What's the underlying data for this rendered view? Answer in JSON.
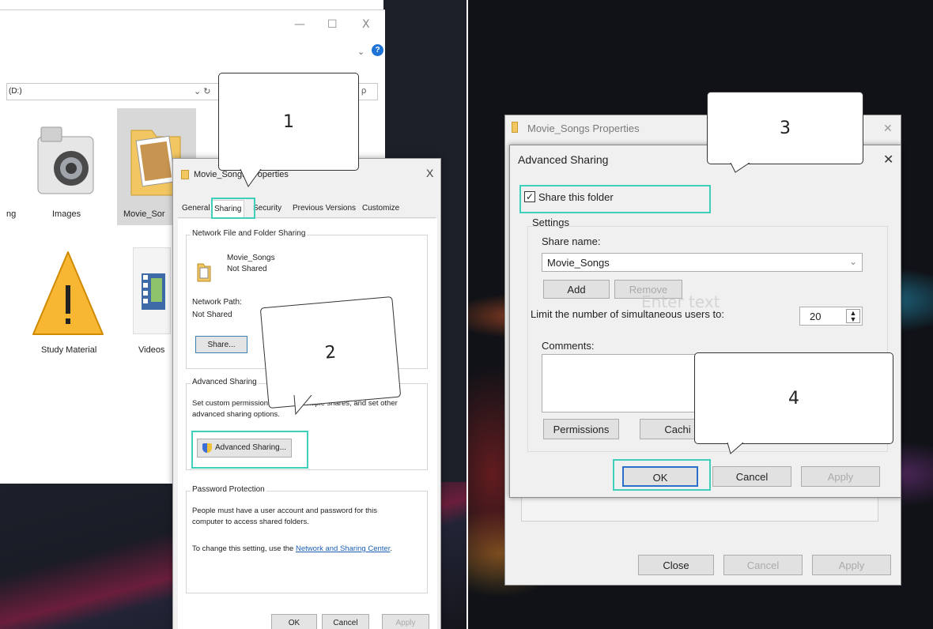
{
  "left": {
    "explorer": {
      "window_controls": {
        "minimize": "—",
        "maximize": "☐",
        "close": "X"
      },
      "drive_label": "(D:)",
      "addr_controls": "⌄ ↻",
      "search_glyph": "ρ",
      "help_glyph": "?",
      "files": [
        {
          "name": "ng"
        },
        {
          "name": "Images"
        },
        {
          "name": "Movie_Sor"
        },
        {
          "name": "Study Material"
        },
        {
          "name": "Videos"
        }
      ]
    },
    "properties": {
      "title": "Movie_Songs Properties",
      "close": "X",
      "tabs": [
        "General",
        "Sharing",
        "Security",
        "Previous Versions",
        "Customize"
      ],
      "network_sharing": {
        "heading": "Network File and Folder Sharing",
        "folder_name": "Movie_Songs",
        "status": "Not Shared",
        "path_label": "Network Path:",
        "path_value": "Not Shared",
        "share_button": "Share..."
      },
      "advanced_sharing": {
        "heading": "Advanced Sharing",
        "description_1": "Set custom permissions, create multiple shares, and set other",
        "description_2": "advanced sharing options.",
        "button": "Advanced Sharing..."
      },
      "password": {
        "heading": "Password Protection",
        "text_1": "People must have a user account and password for this",
        "text_2": "computer to access shared folders.",
        "text_3_prefix": "To change this setting, use the ",
        "link": "Network and Sharing Center",
        "text_3_suffix": "."
      },
      "buttons": {
        "ok": "OK",
        "cancel": "Cancel",
        "apply": "Apply"
      }
    },
    "callouts": {
      "c1": "1",
      "c2": "2"
    }
  },
  "right": {
    "movie_props_title": "Movie_Songs Properties",
    "movie_props_close": "✕",
    "movie_props_buttons": {
      "close": "Close",
      "cancel": "Cancel",
      "apply": "Apply"
    },
    "advanced": {
      "title": "Advanced Sharing",
      "close": "✕",
      "share_checkbox": "Share this folder",
      "settings_label": "Settings",
      "share_name_label": "Share name:",
      "share_name_value": "Movie_Songs",
      "add_button": "Add",
      "remove_button": "Remove",
      "limit_label": "Limit the number of simultaneous users to:",
      "limit_value": "20",
      "comments_label": "Comments:",
      "permissions_button": "Permissions",
      "caching_button": "Cachi",
      "ok": "OK",
      "cancel": "Cancel",
      "apply": "Apply",
      "overlay_text": "Enter text"
    },
    "callouts": {
      "c3": "3",
      "c4": "4"
    }
  },
  "colors": {
    "highlight": "#3fd0bb",
    "link": "#1a5fb4",
    "help": "#1f73d6"
  }
}
